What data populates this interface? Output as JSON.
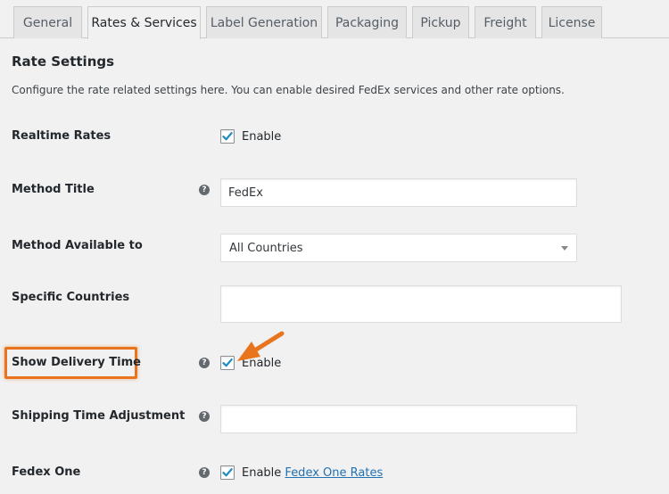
{
  "tabs": [
    {
      "label": "General",
      "active": false
    },
    {
      "label": "Rates & Services",
      "active": true
    },
    {
      "label": "Label Generation",
      "active": false
    },
    {
      "label": "Packaging",
      "active": false
    },
    {
      "label": "Pickup",
      "active": false
    },
    {
      "label": "Freight",
      "active": false
    },
    {
      "label": "License",
      "active": false
    }
  ],
  "section": {
    "title": "Rate Settings",
    "description": "Configure the rate related settings here. You can enable desired FedEx services and other rate options."
  },
  "fields": {
    "realtime_rates": {
      "label": "Realtime Rates",
      "checkbox_label": "Enable",
      "checked": true
    },
    "method_title": {
      "label": "Method Title",
      "value": "FedEx",
      "help": "?"
    },
    "method_available_to": {
      "label": "Method Available to",
      "selected": "All Countries"
    },
    "specific_countries": {
      "label": "Specific Countries",
      "value": ""
    },
    "show_delivery_time": {
      "label": "Show Delivery Time",
      "checkbox_label": "Enable",
      "checked": true,
      "help": "?"
    },
    "shipping_time_adjustment": {
      "label": "Shipping Time Adjustment",
      "value": "",
      "help": "?"
    },
    "fedex_one": {
      "label": "Fedex One",
      "checkbox_label": "Enable",
      "link_text": "Fedex One Rates",
      "checked": true,
      "help": "?"
    }
  },
  "colors": {
    "highlight": "#e8741e",
    "checkmark": "#1e8cbe",
    "link": "#2271b1"
  },
  "icons": {
    "checkmark": "checkmark-icon",
    "help": "help-icon",
    "dropdown": "chevron-down-icon",
    "annotation_arrow": "arrow-icon"
  }
}
